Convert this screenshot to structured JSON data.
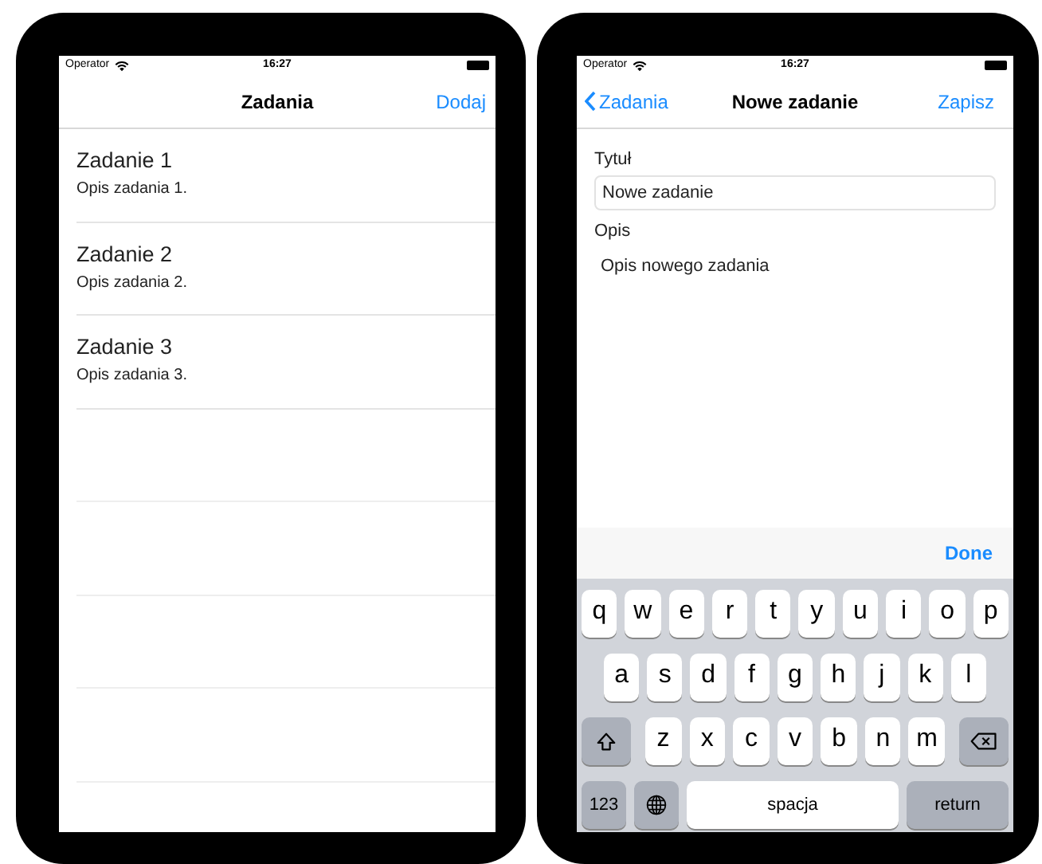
{
  "list_screen": {
    "status_bar": {
      "operator": "Operator",
      "time": "16:27"
    },
    "nav_bar": {
      "title": "Zadania",
      "add_button": "Dodaj"
    },
    "tasks": [
      {
        "title": "Zadanie 1",
        "description": "Opis zadania 1."
      },
      {
        "title": "Zadanie 2",
        "description": "Opis zadania 2."
      },
      {
        "title": "Zadanie 3",
        "description": "Opis zadania 3."
      }
    ]
  },
  "edit_screen": {
    "status_bar": {
      "operator": "Operator",
      "time": "16:27"
    },
    "nav_bar": {
      "back_button": "Zadania",
      "title": "Nowe zadanie",
      "save_button": "Zapisz"
    },
    "title_field": {
      "label": "Tytuł",
      "value": "Nowe zadanie"
    },
    "description_field": {
      "label": "Opis",
      "value": "Opis nowego zadania"
    },
    "toolbar": {
      "done_button": "Done"
    },
    "keyboard": {
      "rows": [
        {
          "keys": [
            {
              "kind": "letter",
              "label": "q"
            },
            {
              "kind": "letter",
              "label": "w"
            },
            {
              "kind": "letter",
              "label": "e"
            },
            {
              "kind": "letter",
              "label": "r"
            },
            {
              "kind": "letter",
              "label": "t"
            },
            {
              "kind": "letter",
              "label": "y"
            },
            {
              "kind": "letter",
              "label": "u"
            },
            {
              "kind": "letter",
              "label": "i"
            },
            {
              "kind": "letter",
              "label": "o"
            },
            {
              "kind": "letter",
              "label": "p"
            }
          ]
        },
        {
          "keys": [
            {
              "kind": "letter",
              "label": "a"
            },
            {
              "kind": "letter",
              "label": "s"
            },
            {
              "kind": "letter",
              "label": "d"
            },
            {
              "kind": "letter",
              "label": "f"
            },
            {
              "kind": "letter",
              "label": "g"
            },
            {
              "kind": "letter",
              "label": "h"
            },
            {
              "kind": "letter",
              "label": "j"
            },
            {
              "kind": "letter",
              "label": "k"
            },
            {
              "kind": "letter",
              "label": "l"
            }
          ]
        },
        {
          "keys": [
            {
              "kind": "shift"
            },
            {
              "kind": "letter",
              "label": "z"
            },
            {
              "kind": "letter",
              "label": "x"
            },
            {
              "kind": "letter",
              "label": "c"
            },
            {
              "kind": "letter",
              "label": "v"
            },
            {
              "kind": "letter",
              "label": "b"
            },
            {
              "kind": "letter",
              "label": "n"
            },
            {
              "kind": "letter",
              "label": "m"
            },
            {
              "kind": "backspace"
            }
          ]
        },
        {
          "keys": [
            {
              "kind": "numbers",
              "label": "123"
            },
            {
              "kind": "globe"
            },
            {
              "kind": "space",
              "label": "spacja"
            },
            {
              "kind": "return",
              "label": "return"
            }
          ]
        }
      ]
    }
  }
}
